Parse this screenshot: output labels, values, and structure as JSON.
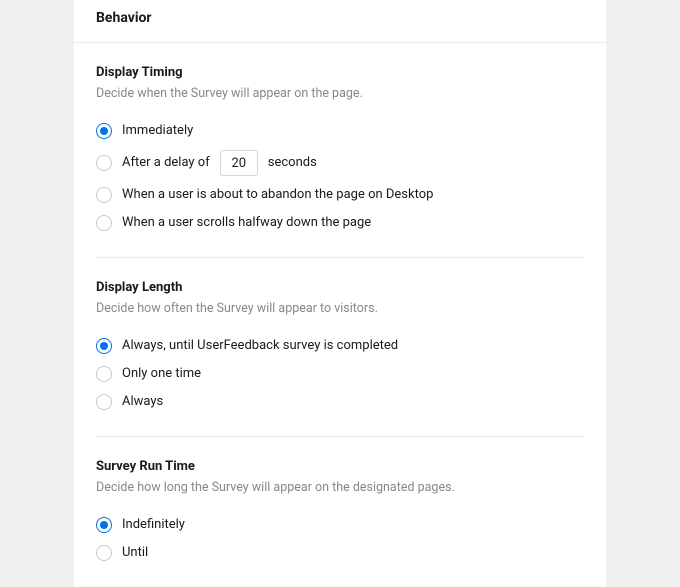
{
  "panel": {
    "title": "Behavior"
  },
  "sections": {
    "display_timing": {
      "heading": "Display Timing",
      "desc": "Decide when the Survey will appear on the page.",
      "options": {
        "immediately": "Immediately",
        "delay_prefix": "After a delay of",
        "delay_value": "20",
        "delay_suffix": "seconds",
        "abandon": "When a user is about to abandon the page on Desktop",
        "scroll": "When a user scrolls halfway down the page"
      }
    },
    "display_length": {
      "heading": "Display Length",
      "desc": "Decide how often the Survey will appear to visitors.",
      "options": {
        "until_complete": "Always, until UserFeedback survey is completed",
        "only_once": "Only one time",
        "always": "Always"
      }
    },
    "run_time": {
      "heading": "Survey Run Time",
      "desc": "Decide how long the Survey will appear on the designated pages.",
      "options": {
        "indefinitely": "Indefinitely",
        "until": "Until"
      }
    }
  }
}
